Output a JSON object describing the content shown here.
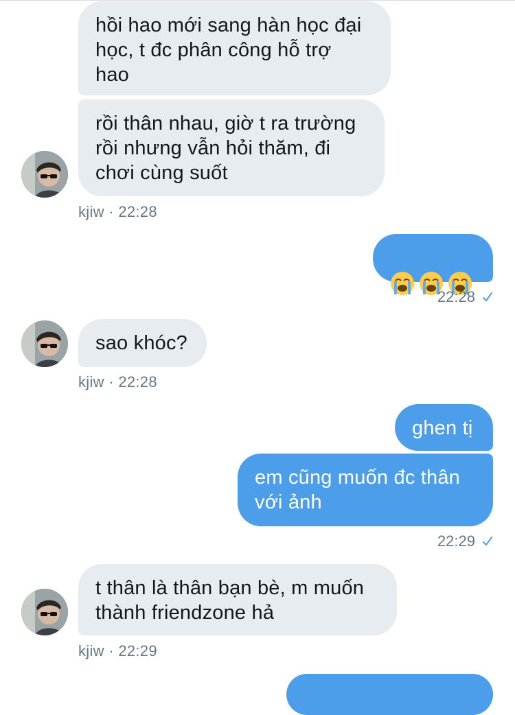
{
  "conversation": {
    "messages": [
      {
        "side": "in",
        "text": "hồi hao mới sang hàn học đại\nhọc, t đc phân công hỗ trợ\nhao"
      },
      {
        "side": "in",
        "text": "rồi thân nhau, giờ t ra trường\nrồi nhưng vẫn hỏi thăm, đi\nchơi cùng suốt"
      },
      {
        "side": "out",
        "text": "😭😭😭",
        "emoji": [
          "loudly-crying-face-icon",
          "loudly-crying-face-icon",
          "loudly-crying-face-icon"
        ]
      },
      {
        "side": "in",
        "text": "sao khóc?"
      },
      {
        "side": "out",
        "text": "ghen tị"
      },
      {
        "side": "out",
        "text": "em cũng muốn đc thân\nvới ảnh"
      },
      {
        "side": "in",
        "text": "t thân là thân bạn bè, m muốn\nthành friendzone hả"
      }
    ],
    "meta": {
      "m1": "kjiw · 22:28",
      "m2": "22:28",
      "m3": "kjiw · 22:28",
      "m4": "22:29",
      "m5": "kjiw · 22:29"
    }
  },
  "colors": {
    "incoming_bubble": "#e6ecf0",
    "outgoing_bubble": "#4c9eeb",
    "meta_text": "#657786",
    "read_check": "#4c9eeb"
  }
}
